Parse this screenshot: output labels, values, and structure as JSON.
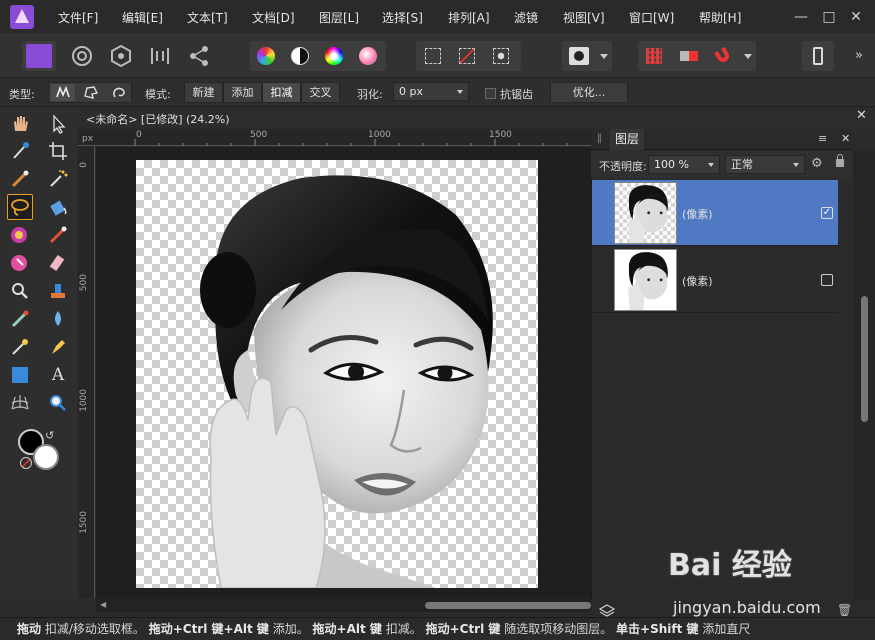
{
  "menubar": {
    "items": [
      "文件[F]",
      "编辑[E]",
      "文本[T]",
      "文档[D]",
      "图层[L]",
      "选择[S]",
      "排列[A]",
      "滤镜",
      "视图[V]",
      "窗口[W]",
      "帮助[H]"
    ]
  },
  "context": {
    "type_label": "类型:",
    "mode_label": "模式:",
    "modes": [
      "新建",
      "添加",
      "扣减",
      "交叉"
    ],
    "active_mode": "扣减",
    "feather_label": "羽化:",
    "feather_value": "0 px",
    "antialias_label": "抗锯齿",
    "refine_label": "优化..."
  },
  "document": {
    "title": "<未命名> [已修改] (24.2%)",
    "ruler_unit": "px",
    "ruler_h_ticks": [
      "0",
      "500",
      "1000",
      "1500"
    ],
    "ruler_v_ticks": [
      "0",
      "500",
      "1000",
      "1500"
    ]
  },
  "layers_panel": {
    "title": "图层",
    "opacity_label": "不透明度:",
    "opacity_value": "100 %",
    "blend_mode": "正常",
    "layers": [
      {
        "name": "(像素)",
        "selected": true,
        "visible": true
      },
      {
        "name": "(像素)",
        "selected": false,
        "visible": false
      }
    ]
  },
  "status": {
    "segments": [
      {
        "bold": "拖动",
        "text": " 扣减/移动选取框。"
      },
      {
        "bold": "拖动+Ctrl 键+Alt 键",
        "text": " 添加。"
      },
      {
        "bold": "拖动+Alt 键",
        "text": " 扣减。"
      },
      {
        "bold": "拖动+Ctrl 键",
        "text": " 随选取项移动图层。"
      },
      {
        "bold": "单击+Shift 键",
        "text": " 添加直尺"
      }
    ]
  },
  "watermark": {
    "text": "Bai 经验",
    "url": "jingyan.baidu.com"
  },
  "colors": {
    "accent": "#e7a31f",
    "selected_layer": "#4f79c3",
    "app_logo": "#8a4bd6"
  }
}
